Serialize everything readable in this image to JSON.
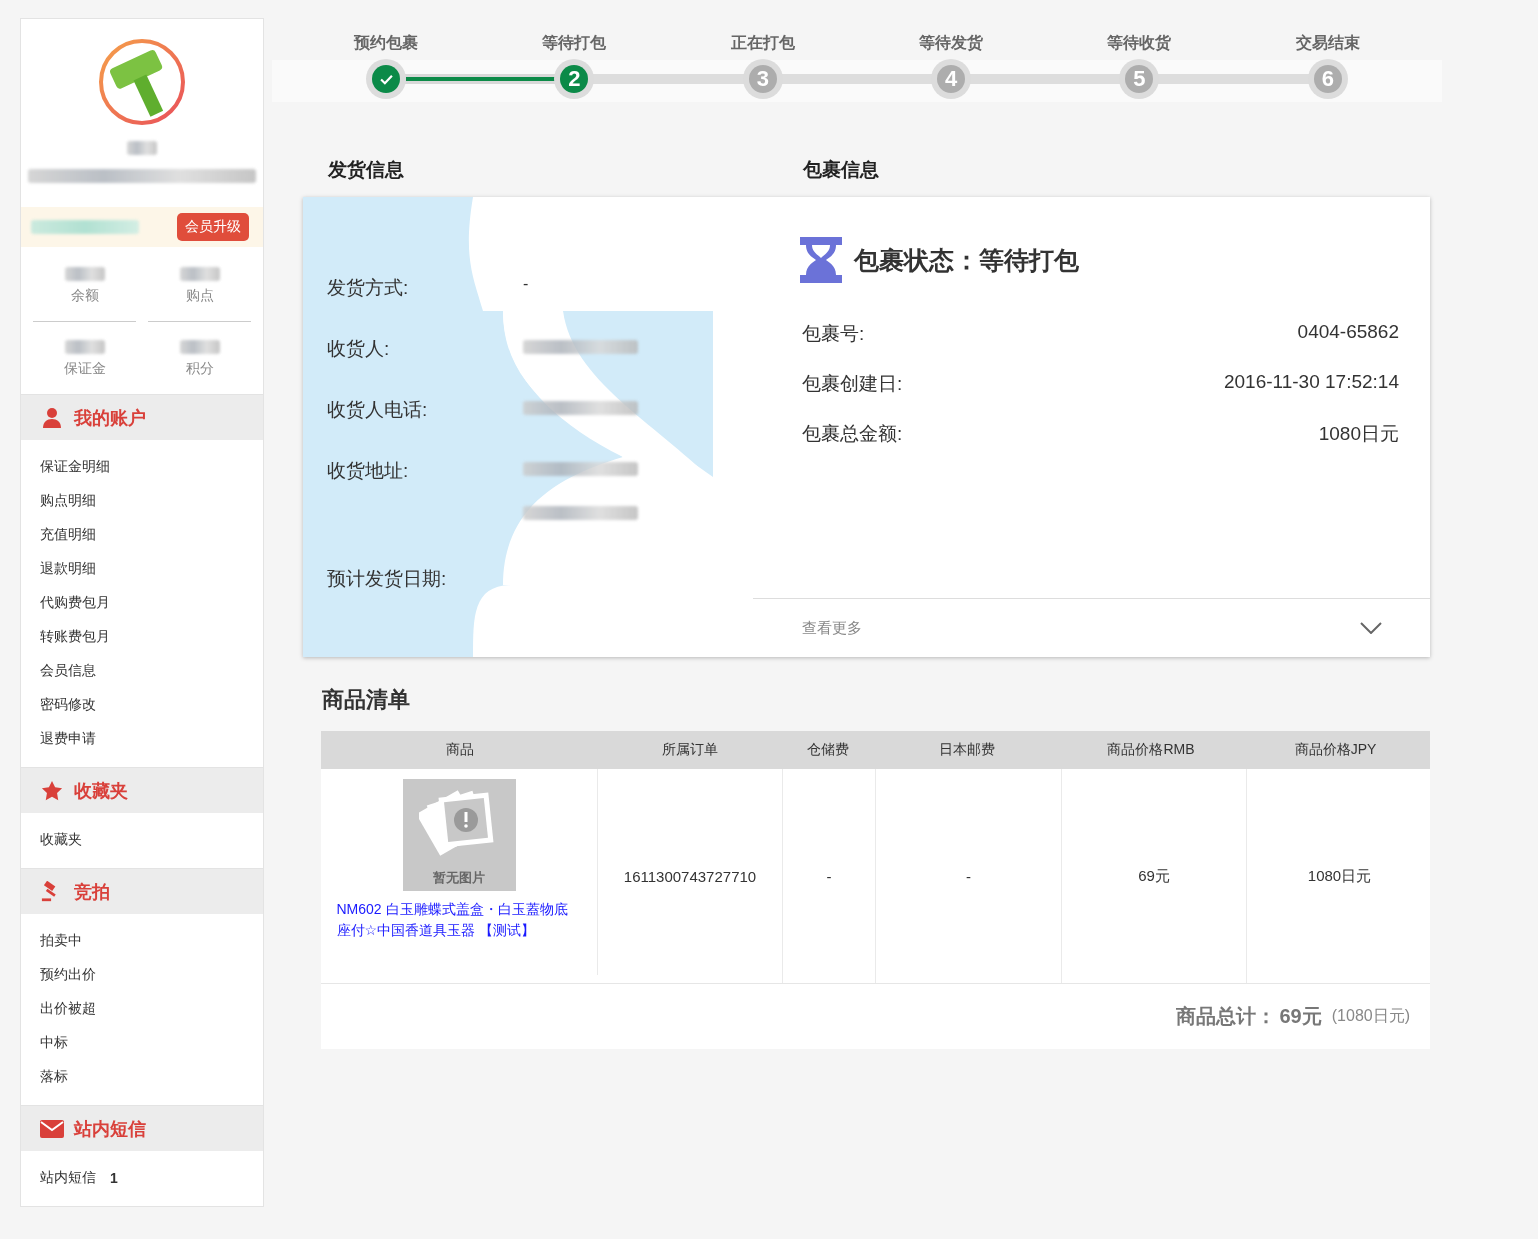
{
  "sidebar": {
    "upgrade_button": "会员升级",
    "stats": [
      {
        "label": "余额"
      },
      {
        "label": "购点"
      },
      {
        "label": "保证金"
      },
      {
        "label": "积分"
      }
    ],
    "sections": [
      {
        "kind": "account",
        "title": "我的账户",
        "items": [
          {
            "label": "保证金明细"
          },
          {
            "label": "购点明细"
          },
          {
            "label": "充值明细"
          },
          {
            "label": "退款明细"
          },
          {
            "label": "代购费包月"
          },
          {
            "label": "转账费包月"
          },
          {
            "label": "会员信息"
          },
          {
            "label": "密码修改"
          },
          {
            "label": "退费申请"
          }
        ]
      },
      {
        "kind": "favorites",
        "title": "收藏夹",
        "items": [
          {
            "label": "收藏夹"
          }
        ]
      },
      {
        "kind": "auction",
        "title": "竞拍",
        "items": [
          {
            "label": "拍卖中"
          },
          {
            "label": "预约出价"
          },
          {
            "label": "出价被超"
          },
          {
            "label": "中标"
          },
          {
            "label": "落标"
          }
        ]
      },
      {
        "kind": "messages",
        "title": "站内短信",
        "items": [
          {
            "label": "站内短信",
            "count": "1"
          }
        ]
      }
    ]
  },
  "steps": [
    {
      "label": "预约包裹",
      "done": true,
      "selected": false
    },
    {
      "label": "等待打包",
      "number": "2",
      "done": false,
      "selected": true
    },
    {
      "label": "正在打包",
      "number": "3",
      "done": false,
      "selected": false
    },
    {
      "label": "等待发货",
      "number": "4",
      "done": false,
      "selected": false
    },
    {
      "label": "等待收货",
      "number": "5",
      "done": false,
      "selected": false
    },
    {
      "label": "交易结束",
      "number": "6",
      "done": false,
      "selected": false
    }
  ],
  "shipping": {
    "title": "发货信息",
    "rows": [
      {
        "kind": "text",
        "label": "发货方式:",
        "value": "-"
      },
      {
        "kind": "blurred",
        "label": "收货人:"
      },
      {
        "kind": "blurred",
        "label": "收货人电话:"
      },
      {
        "kind": "blurred_address",
        "label": "收货地址:"
      },
      {
        "kind": "empty",
        "label": "预计发货日期:"
      }
    ]
  },
  "package": {
    "title": "包裹信息",
    "status_label": "包裹状态：",
    "status": "等待打包",
    "rows": [
      {
        "label": "包裹号:",
        "value": "0404-65862"
      },
      {
        "label": "包裹创建日:",
        "value": "2016-11-30 17:52:14"
      },
      {
        "label": "包裹总金额:",
        "value": "1080日元"
      }
    ],
    "more": "查看更多"
  },
  "goods": {
    "title": "商品清单",
    "columns": [
      "商品",
      "所属订单",
      "仓储费",
      "日本邮费",
      "商品价格RMB",
      "商品价格JPY"
    ],
    "rows": [
      {
        "no_image": "暂无图片",
        "name": "NM602 白玉雕蝶式盖盒・白玉蓋物底座付☆中国香道具玉器 【测试】",
        "order": "1611300743727710",
        "storage": "-",
        "postage": "-",
        "rmb": "69元",
        "jpy": "1080日元"
      }
    ],
    "total_label": "商品总计：",
    "total": "69元",
    "total_jpy": "(1080日元)"
  }
}
